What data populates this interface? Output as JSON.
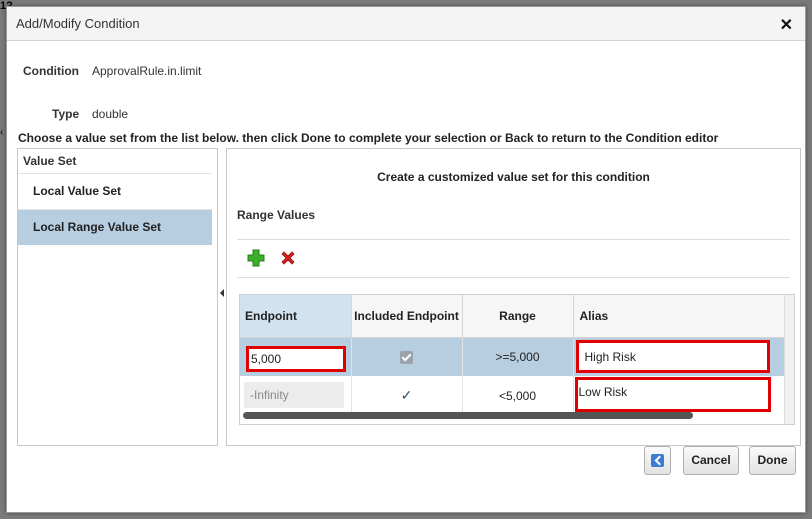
{
  "dialog": {
    "title": "Add/Modify Condition",
    "close_glyph": "✕"
  },
  "condition": {
    "label": "Condition",
    "value": "ApprovalRule.in.limit"
  },
  "type": {
    "label": "Type",
    "value": "double"
  },
  "instruction": "Choose a value set from the list below. then click Done to complete your selection or Back to return to the Condition editor",
  "value_set": {
    "header": "Value Set",
    "items": [
      {
        "label": "Local Value Set",
        "selected": false
      },
      {
        "label": "Local Range Value Set",
        "selected": true
      }
    ]
  },
  "right_panel": {
    "title": "Create a customized value set for this condition",
    "subtitle": "Range Values",
    "add_icon": "plus-icon",
    "delete_icon": "delete-x-icon"
  },
  "grid": {
    "columns": [
      "Endpoint",
      "Included Endpoint",
      "Range",
      "Alias"
    ],
    "rows": [
      {
        "endpoint": "5,000",
        "included": "checkbox",
        "range": ">=5,000",
        "alias": "High Risk"
      },
      {
        "endpoint": "-Infinity",
        "included": "✓",
        "range": "<5,000",
        "alias": "Low Risk"
      }
    ]
  },
  "buttons": {
    "back_icon": "chevron-left-icon",
    "cancel": "Cancel",
    "done": "Done"
  },
  "colors": {
    "highlight_border": "#e00000",
    "selection": "#b7cde0",
    "add_green": "#3cb02a",
    "delete_red": "#d62020"
  },
  "background": {
    "corner_text": "1?",
    "caret": "‹"
  }
}
